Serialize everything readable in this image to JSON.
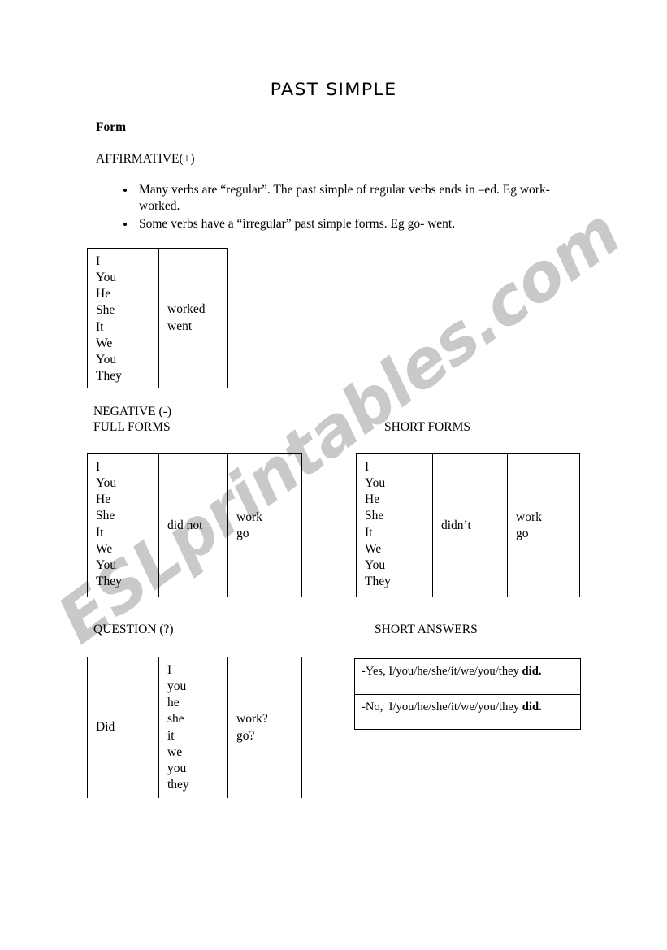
{
  "document": {
    "title": "PAST SIMPLE",
    "form_label": "Form",
    "affirmative_label": "AFFIRMATIVE(+)",
    "bullets": [
      "Many verbs are “regular”. The past simple of regular verbs ends in –ed. Eg work- worked.",
      "Some verbs have a “irregular” past simple forms. Eg go- went."
    ],
    "watermark": "ESLprintables.com",
    "watermark_color": "#c9c9c9"
  },
  "affirmative_table": {
    "pronouns": [
      "I",
      "You",
      "He",
      "She",
      "It",
      "We",
      "You",
      "They"
    ],
    "verbs": [
      "worked",
      "went"
    ]
  },
  "negative": {
    "heading_line1": "NEGATIVE (-)",
    "heading_line2": "FULL FORMS",
    "short_forms_heading": "SHORT FORMS",
    "full_forms_table": {
      "pronouns": [
        "I",
        "You",
        "He",
        "She",
        "It",
        "We",
        "You",
        "They"
      ],
      "auxiliary": [
        "did not"
      ],
      "verbs": [
        "work",
        "go"
      ]
    },
    "short_forms_table": {
      "pronouns": [
        "I",
        "You",
        "He",
        "She",
        "It",
        "We",
        "You",
        "They"
      ],
      "auxiliary": [
        "didn’t"
      ],
      "verbs": [
        "work",
        "go"
      ]
    }
  },
  "question": {
    "heading": "QUESTION (?)",
    "table": {
      "auxiliary": [
        "Did"
      ],
      "pronouns": [
        "I",
        "you",
        "he",
        "she",
        "it",
        "we",
        "you",
        "they"
      ],
      "verbs": [
        "work?",
        "go?"
      ]
    }
  },
  "short_answers": {
    "heading": "SHORT ANSWERS",
    "rows": [
      {
        "text": "-Yes, I/you/he/she/it/we/you/they ",
        "bold": "did."
      },
      {
        "text": "-No,  I/you/he/she/it/we/you/they ",
        "bold": "did."
      }
    ]
  }
}
